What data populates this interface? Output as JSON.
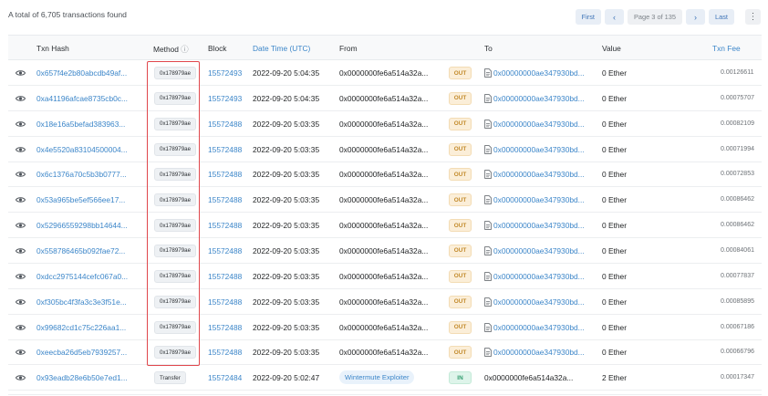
{
  "summary": "A total of 6,705 transactions found",
  "pager": {
    "first": "First",
    "prev": "‹",
    "page": "Page 3 of 135",
    "next": "›",
    "last": "Last",
    "more": "⋮"
  },
  "headers": {
    "txn_hash": "Txn Hash",
    "method": "Method",
    "method_info": "ⓘ",
    "block": "Block",
    "datetime": "Date Time (UTC)",
    "from": "From",
    "to": "To",
    "value": "Value",
    "fee": "Txn Fee"
  },
  "colors": {
    "link": "#3c86c9",
    "out": "#c28a2b",
    "in": "#2f9b6c",
    "highlight": "#e0474c"
  },
  "rows": [
    {
      "hash": "0x657f4e2b80abcdb49af...",
      "method": "0x178979ae",
      "block": "15572493",
      "time": "2022-09-20 5:04:35",
      "from": "0x0000000fe6a514a32a...",
      "dir": "OUT",
      "to": "0x00000000ae347930bd...",
      "value": "0 Ether",
      "fee": "0.00126611"
    },
    {
      "hash": "0xa41196afcae8735cb0c...",
      "method": "0x178979ae",
      "block": "15572493",
      "time": "2022-09-20 5:04:35",
      "from": "0x0000000fe6a514a32a...",
      "dir": "OUT",
      "to": "0x00000000ae347930bd...",
      "value": "0 Ether",
      "fee": "0.00075707"
    },
    {
      "hash": "0x18e16a5befad383963...",
      "method": "0x178979ae",
      "block": "15572488",
      "time": "2022-09-20 5:03:35",
      "from": "0x0000000fe6a514a32a...",
      "dir": "OUT",
      "to": "0x00000000ae347930bd...",
      "value": "0 Ether",
      "fee": "0.00082109"
    },
    {
      "hash": "0x4e5520a83104500004...",
      "method": "0x178979ae",
      "block": "15572488",
      "time": "2022-09-20 5:03:35",
      "from": "0x0000000fe6a514a32a...",
      "dir": "OUT",
      "to": "0x00000000ae347930bd...",
      "value": "0 Ether",
      "fee": "0.00071994"
    },
    {
      "hash": "0x6c1376a70c5b3b0777...",
      "method": "0x178979ae",
      "block": "15572488",
      "time": "2022-09-20 5:03:35",
      "from": "0x0000000fe6a514a32a...",
      "dir": "OUT",
      "to": "0x00000000ae347930bd...",
      "value": "0 Ether",
      "fee": "0.00072853"
    },
    {
      "hash": "0x53a965be5ef566ee17...",
      "method": "0x178979ae",
      "block": "15572488",
      "time": "2022-09-20 5:03:35",
      "from": "0x0000000fe6a514a32a...",
      "dir": "OUT",
      "to": "0x00000000ae347930bd...",
      "value": "0 Ether",
      "fee": "0.00086462"
    },
    {
      "hash": "0x52966559298bb14644...",
      "method": "0x178979ae",
      "block": "15572488",
      "time": "2022-09-20 5:03:35",
      "from": "0x0000000fe6a514a32a...",
      "dir": "OUT",
      "to": "0x00000000ae347930bd...",
      "value": "0 Ether",
      "fee": "0.00086462"
    },
    {
      "hash": "0x558786465b092fae72...",
      "method": "0x178979ae",
      "block": "15572488",
      "time": "2022-09-20 5:03:35",
      "from": "0x0000000fe6a514a32a...",
      "dir": "OUT",
      "to": "0x00000000ae347930bd...",
      "value": "0 Ether",
      "fee": "0.00084061"
    },
    {
      "hash": "0xdcc2975144cefc067a0...",
      "method": "0x178979ae",
      "block": "15572488",
      "time": "2022-09-20 5:03:35",
      "from": "0x0000000fe6a514a32a...",
      "dir": "OUT",
      "to": "0x00000000ae347930bd...",
      "value": "0 Ether",
      "fee": "0.00077837"
    },
    {
      "hash": "0xf305bc4f3fa3c3e3f51e...",
      "method": "0x178979ae",
      "block": "15572488",
      "time": "2022-09-20 5:03:35",
      "from": "0x0000000fe6a514a32a...",
      "dir": "OUT",
      "to": "0x00000000ae347930bd...",
      "value": "0 Ether",
      "fee": "0.00085895"
    },
    {
      "hash": "0x99682cd1c75c226aa1...",
      "method": "0x178979ae",
      "block": "15572488",
      "time": "2022-09-20 5:03:35",
      "from": "0x0000000fe6a514a32a...",
      "dir": "OUT",
      "to": "0x00000000ae347930bd...",
      "value": "0 Ether",
      "fee": "0.00067186"
    },
    {
      "hash": "0xeecba26d5eb7939257...",
      "method": "0x178979ae",
      "block": "15572488",
      "time": "2022-09-20 5:03:35",
      "from": "0x0000000fe6a514a32a...",
      "dir": "OUT",
      "to": "0x00000000ae347930bd...",
      "value": "0 Ether",
      "fee": "0.00066796"
    },
    {
      "hash": "0x93eadb28e6b50e7ed1...",
      "method": "Transfer",
      "block": "15572484",
      "time": "2022-09-20 5:02:47",
      "from": "Wintermute Exploiter",
      "from_tag": true,
      "dir": "IN",
      "to": "0x0000000fe6a514a32a...",
      "to_plain": true,
      "value": "2 Ether",
      "fee": "0.00017347"
    }
  ]
}
